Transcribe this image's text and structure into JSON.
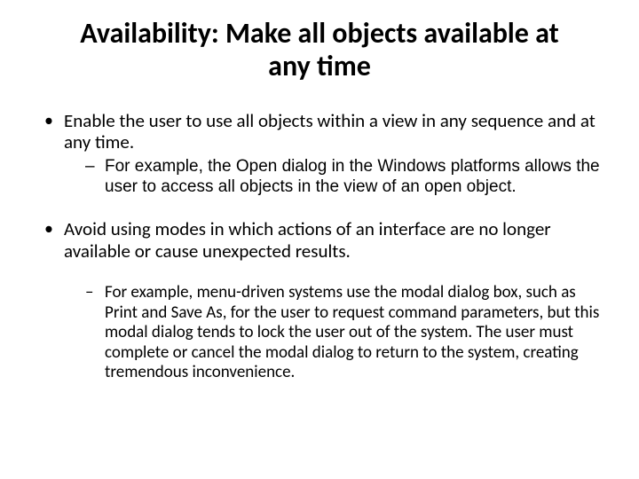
{
  "title": "Availability: Make all objects available at any time",
  "bullets": [
    {
      "text": "Enable the user to use all objects within a view in any sequence and at any time.",
      "sub": [
        "For example, the Open dialog in the Windows platforms allows the user to access all objects in the view of an open object."
      ]
    },
    {
      "text": "Avoid using modes in which actions of an interface are no longer available or cause unexpected results.",
      "sub": [
        "For example, menu-driven systems use the modal dialog box, such as Print and Save As, for the user to request command parameters, but this modal dialog tends to lock the user out of the system. The user must complete or cancel the modal dialog to return to the system, creating tremendous inconvenience."
      ]
    }
  ]
}
